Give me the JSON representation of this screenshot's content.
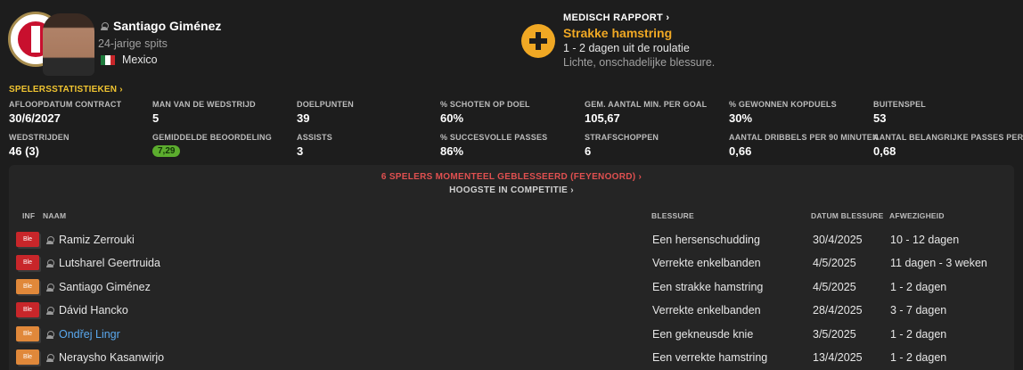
{
  "player": {
    "name": "Santiago Giménez",
    "age_position": "24-jarige spits",
    "nationality": "Mexico"
  },
  "medical": {
    "link_label": "MEDISCH RAPPORT ›",
    "injury": "Strakke hamstring",
    "duration": "1 - 2 dagen uit de roulatie",
    "description": "Lichte, onschadelijke blessure."
  },
  "stats_link": "SPELERSSTATISTIEKEN ›",
  "stats": [
    {
      "label": "AFLOOPDATUM CONTRACT",
      "value": "30/6/2027"
    },
    {
      "label": "MAN VAN DE WEDSTRIJD",
      "value": "5"
    },
    {
      "label": "DOELPUNTEN",
      "value": "39"
    },
    {
      "label": "% SCHOTEN OP DOEL",
      "value": "60%"
    },
    {
      "label": "GEM. AANTAL MIN. PER GOAL",
      "value": "105,67"
    },
    {
      "label": "% GEWONNEN KOPDUELS",
      "value": "30%"
    },
    {
      "label": "BUITENSPEL",
      "value": "53"
    },
    {
      "label": "WEDSTRIJDEN",
      "value": "46 (3)"
    },
    {
      "label": "GEMIDDELDE BEOORDELING",
      "value": "7,29"
    },
    {
      "label": "ASSISTS",
      "value": "3"
    },
    {
      "label": "% SUCCESVOLLE PASSES",
      "value": "86%"
    },
    {
      "label": "STRAFSCHOPPEN",
      "value": "6"
    },
    {
      "label": "AANTAL DRIBBELS PER 90 MINUTEN",
      "value": "0,66"
    },
    {
      "label": "AANTAL BELANGRIJKE PASSES PER...",
      "value": "0,68"
    }
  ],
  "injury_panel": {
    "title": "6 SPELERS MOMENTEEL GEBLESSEERD (FEYENOORD) ›",
    "subtitle": "HOOGSTE IN COMPETITIE ›",
    "headers": {
      "inf": "INF",
      "name": "NAAM",
      "injury": "BLESSURE",
      "date": "DATUM BLESSURE",
      "absence": "AFWEZIGHEID"
    },
    "rows": [
      {
        "tag": "Ble",
        "tag_color": "#c8262a",
        "name": "Ramiz Zerrouki",
        "injury": "Een hersenschudding",
        "date": "30/4/2025",
        "absence": "10 - 12 dagen"
      },
      {
        "tag": "Ble",
        "tag_color": "#c8262a",
        "name": "Lutsharel Geertruida",
        "injury": "Verrekte enkelbanden",
        "date": "4/5/2025",
        "absence": "11 dagen - 3 weken"
      },
      {
        "tag": "Ble",
        "tag_color": "#e0883a",
        "name": "Santiago Giménez",
        "injury": "Een strakke hamstring",
        "date": "4/5/2025",
        "absence": "1 - 2 dagen"
      },
      {
        "tag": "Ble",
        "tag_color": "#c8262a",
        "name": "Dávid Hancko",
        "injury": "Verrekte enkelbanden",
        "date": "28/4/2025",
        "absence": "3 - 7 dagen"
      },
      {
        "tag": "Ble",
        "tag_color": "#e0883a",
        "name": "Ondřej Lingr",
        "injury": "Een gekneusde knie",
        "date": "3/5/2025",
        "absence": "1 - 2 dagen"
      },
      {
        "tag": "Ble",
        "tag_color": "#e0883a",
        "name": "Neraysho Kasanwirjo",
        "injury": "Een verrekte hamstring",
        "date": "13/4/2025",
        "absence": "1 - 2 dagen"
      }
    ]
  }
}
